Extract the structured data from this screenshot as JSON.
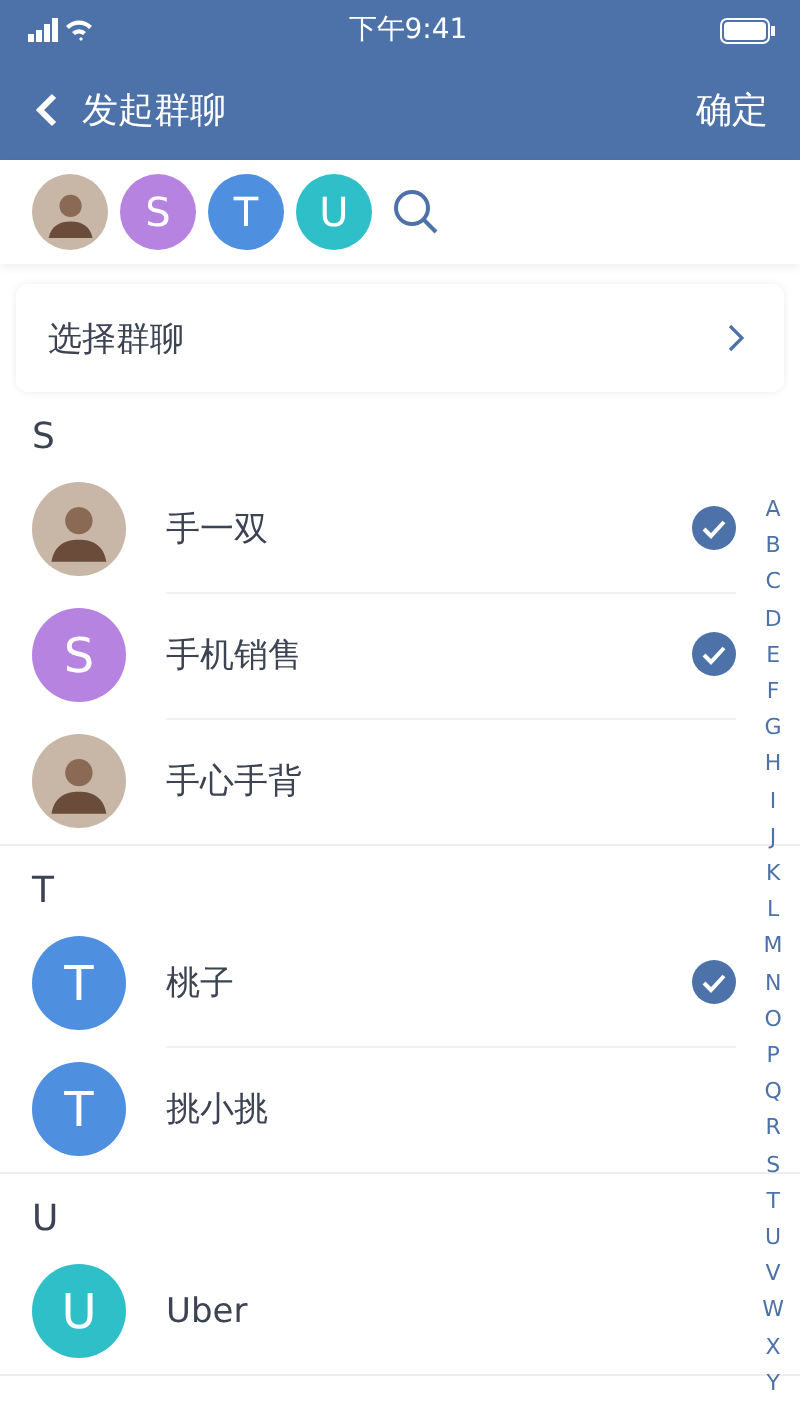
{
  "status_bar": {
    "time": "下午9:41"
  },
  "nav": {
    "title": "发起群聊",
    "confirm": "确定"
  },
  "selected_members": [
    {
      "kind": "photo"
    },
    {
      "kind": "letter",
      "letter": "S",
      "color": "#b684e0"
    },
    {
      "kind": "letter",
      "letter": "T",
      "color": "#4f8fe0"
    },
    {
      "kind": "letter",
      "letter": "U",
      "color": "#2fbfc8"
    }
  ],
  "select_group": {
    "label": "选择群聊"
  },
  "sections": [
    {
      "header": "S",
      "contacts": [
        {
          "name": "手一双",
          "avatar": {
            "kind": "photo"
          },
          "selected": true
        },
        {
          "name": "手机销售",
          "avatar": {
            "kind": "letter",
            "letter": "S",
            "color": "#b684e0"
          },
          "selected": true
        },
        {
          "name": "手心手背",
          "avatar": {
            "kind": "photo"
          },
          "selected": false
        }
      ]
    },
    {
      "header": "T",
      "contacts": [
        {
          "name": "桃子",
          "avatar": {
            "kind": "letter",
            "letter": "T",
            "color": "#4f8fe0"
          },
          "selected": true
        },
        {
          "name": "挑小挑",
          "avatar": {
            "kind": "letter",
            "letter": "T",
            "color": "#4f8fe0"
          },
          "selected": false
        }
      ]
    },
    {
      "header": "U",
      "contacts": [
        {
          "name": "Uber",
          "avatar": {
            "kind": "letter",
            "letter": "U",
            "color": "#2fbfc8"
          },
          "selected": false
        }
      ]
    }
  ],
  "index": [
    "A",
    "B",
    "C",
    "D",
    "E",
    "F",
    "G",
    "H",
    "I",
    "J",
    "K",
    "L",
    "M",
    "N",
    "O",
    "P",
    "Q",
    "R",
    "S",
    "T",
    "U",
    "V",
    "W",
    "X",
    "Y"
  ]
}
